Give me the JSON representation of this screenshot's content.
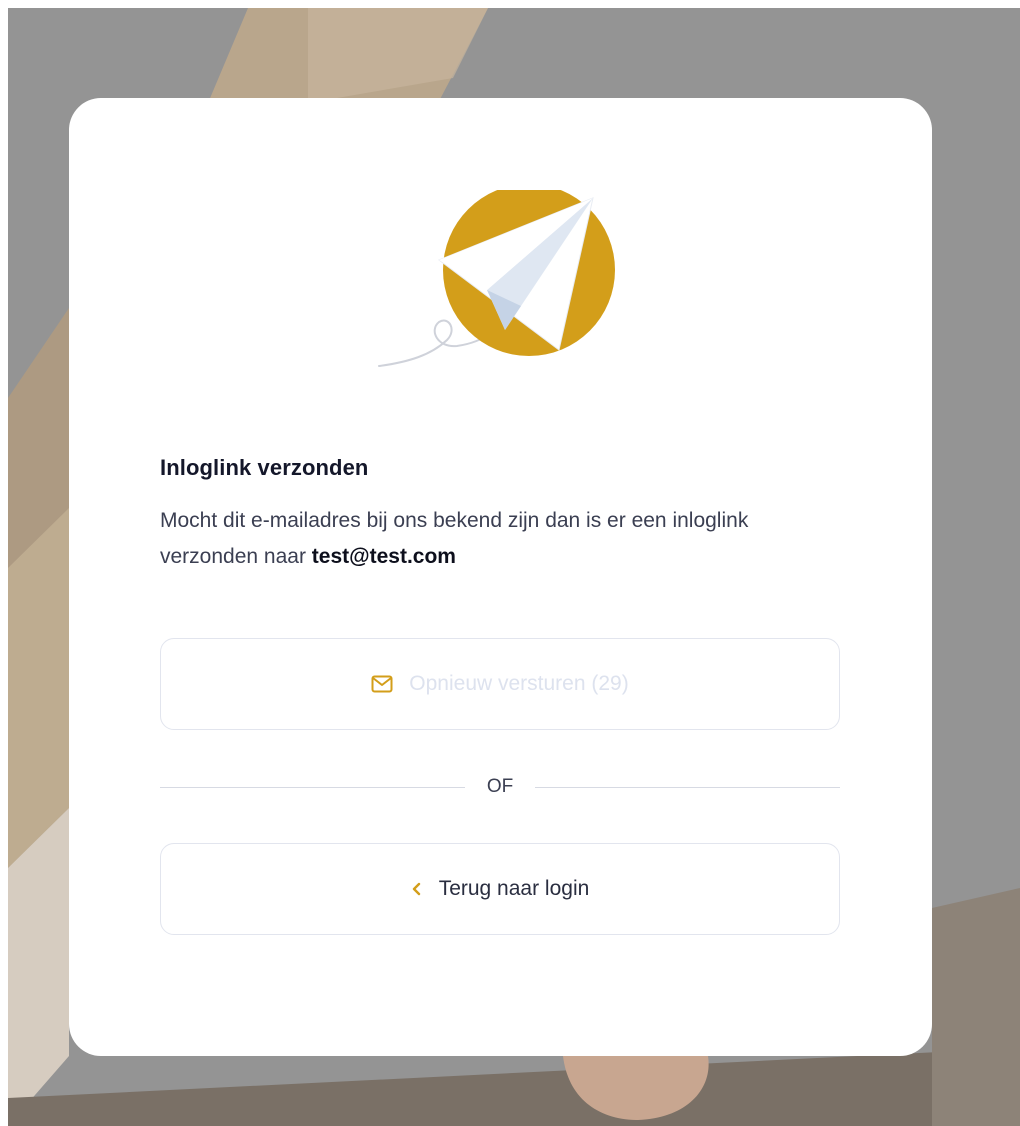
{
  "card": {
    "title": "Inloglink verzonden",
    "message_text": "Mocht dit e-mailadres bij ons bekend zijn dan is er een inloglink verzonden naar",
    "email": "test@test.com"
  },
  "resend_button": {
    "label": "Opnieuw versturen (29)",
    "icon": "envelope-icon",
    "disabled": true
  },
  "divider": {
    "label": "OF"
  },
  "back_button": {
    "label": "Terug naar login",
    "icon": "chevron-left-icon"
  },
  "colors": {
    "accent": "#d39e1a",
    "title": "#14172a",
    "body_text": "#3b3f52",
    "disabled_text": "#dde2ee",
    "border": "#e2e5ee"
  }
}
